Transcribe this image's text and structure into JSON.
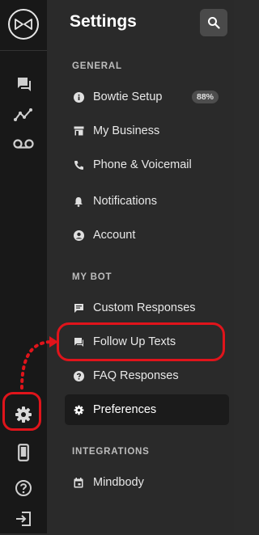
{
  "rail": {
    "logo": "bowtie-logo",
    "items": [
      {
        "name": "messages-icon"
      },
      {
        "name": "analytics-icon"
      },
      {
        "name": "voicemail-icon"
      },
      {
        "name": "settings-icon"
      },
      {
        "name": "mobile-icon"
      },
      {
        "name": "help-icon"
      },
      {
        "name": "logout-icon"
      }
    ]
  },
  "header": {
    "title": "Settings",
    "search_icon": "search-icon"
  },
  "sections": {
    "general": "GENERAL",
    "my_bot": "MY BOT",
    "integrations": "INTEGRATIONS"
  },
  "items": {
    "bowtie_setup": {
      "label": "Bowtie Setup",
      "badge": "88%",
      "icon": "info-icon"
    },
    "my_business": {
      "label": "My Business",
      "icon": "store-icon"
    },
    "phone_voicemail": {
      "label": "Phone & Voicemail",
      "icon": "phone-icon"
    },
    "notifications": {
      "label": "Notifications",
      "icon": "bell-icon"
    },
    "account": {
      "label": "Account",
      "icon": "account-icon"
    },
    "custom_responses": {
      "label": "Custom Responses",
      "icon": "chat-icon"
    },
    "follow_up_texts": {
      "label": "Follow Up Texts",
      "icon": "chat-forward-icon"
    },
    "faq_responses": {
      "label": "FAQ Responses",
      "icon": "question-icon"
    },
    "preferences": {
      "label": "Preferences",
      "icon": "gear-icon",
      "active": true
    },
    "mindbody": {
      "label": "Mindbody",
      "icon": "calendar-icon"
    }
  },
  "colors": {
    "rail_bg": "#181818",
    "panel_bg": "#2a2a2a",
    "active_bg": "#1b1b1b",
    "annotation": "#e0141b",
    "badge_bg": "#4d4d4d"
  }
}
